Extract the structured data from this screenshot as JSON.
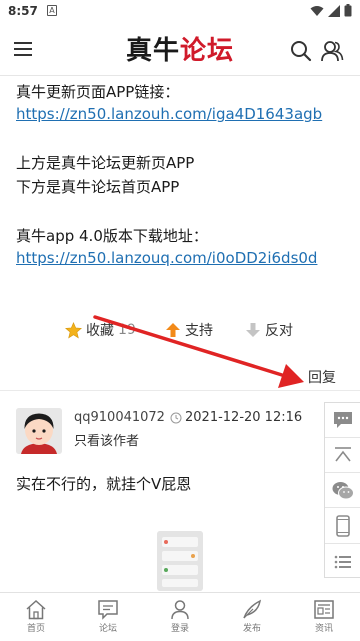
{
  "status_bar": {
    "time": "8:57",
    "notification_badge": "A",
    "icons": [
      "wifi-icon",
      "signal-icon",
      "battery-icon"
    ]
  },
  "header": {
    "logo_part1": "真牛",
    "logo_part2": "论坛",
    "logo_color": "#d01a2a"
  },
  "post": {
    "line1": "真牛更新页面APP链接：",
    "link1": "https://zn50.lanzouh.com/iga4D1643agb",
    "line2": "上方是真牛论坛更新页APP",
    "line3": "下方是真牛论坛首页APP",
    "line4": "真牛app 4.0版本下载地址：",
    "link2": "https://zn50.lanzouq.com/i0oDD2i6ds0d"
  },
  "actions": {
    "favorite_label": "收藏",
    "favorite_count": "19",
    "support_label": "支持",
    "oppose_label": "反对"
  },
  "reply_label": "回复",
  "comment": {
    "username": "qq910041072",
    "time": "2021-12-20 12:16",
    "only_author": "只看该作者",
    "text": "实在不行的，就挂个V屁恩"
  },
  "side_bar": [
    "chat-icon",
    "back-to-top-icon",
    "wechat-icon",
    "phone-icon",
    "list-icon"
  ],
  "bottom_nav": [
    {
      "label": "首页",
      "icon": "home-icon"
    },
    {
      "label": "论坛",
      "icon": "forum-icon"
    },
    {
      "label": "登录",
      "icon": "user-icon"
    },
    {
      "label": "发布",
      "icon": "feather-icon"
    },
    {
      "label": "资讯",
      "icon": "news-icon"
    }
  ]
}
